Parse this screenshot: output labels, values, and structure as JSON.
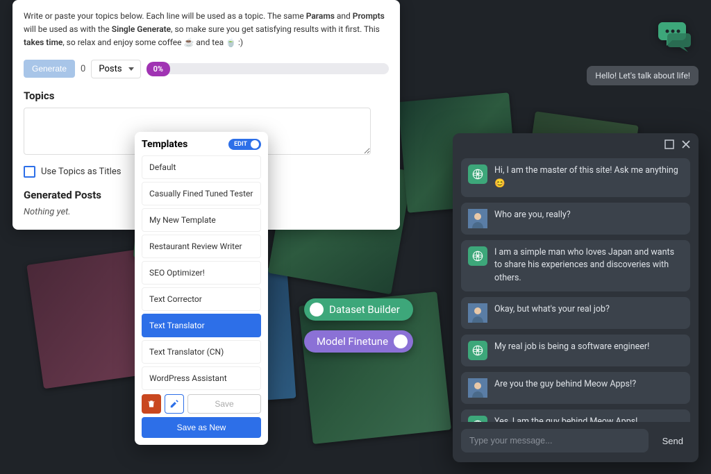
{
  "editor": {
    "intro_parts": {
      "t1": "Write or paste your topics below. Each line will be used as a topic. The same ",
      "b1": "Params",
      "t2": " and ",
      "b2": "Prompts",
      "t3": " will be used as with the ",
      "b3": "Single Generate",
      "t4": ", so make sure you get satisfying results with it first. This ",
      "b4": "takes time",
      "t5": ", so relax and enjoy some coffee ☕ and tea 🍵 :)"
    },
    "generate_label": "Generate",
    "count": "0",
    "select_label": "Posts",
    "progress": "0%",
    "topics_title": "Topics",
    "checkbox_label": "Use Topics as Titles",
    "generated_title": "Generated Posts",
    "nothing": "Nothing yet."
  },
  "templates": {
    "title": "Templates",
    "edit_label": "EDIT",
    "items": [
      {
        "label": "Default"
      },
      {
        "label": "Casually Fined Tuned Tester"
      },
      {
        "label": "My New Template"
      },
      {
        "label": "Restaurant Review Writer"
      },
      {
        "label": "SEO Optimizer!"
      },
      {
        "label": "Text Corrector"
      },
      {
        "label": "Text Translator"
      },
      {
        "label": "Text Translator (CN)"
      },
      {
        "label": "WordPress Assistant"
      }
    ],
    "selected_index": 6,
    "save_label": "Save",
    "save_new_label": "Save as New"
  },
  "pills": {
    "dataset": "Dataset Builder",
    "finetune": "Model Finetune"
  },
  "hello": "Hello! Let's talk about life!",
  "chat": {
    "messages": [
      {
        "role": "ai",
        "text": "Hi, I am the master of this site! Ask me anything 😊"
      },
      {
        "role": "user",
        "text": "Who are you, really?"
      },
      {
        "role": "ai",
        "text": "I am a simple man who loves Japan and wants to share his experiences and discoveries with others."
      },
      {
        "role": "user",
        "text": "Okay, but what's your real job?"
      },
      {
        "role": "ai",
        "text": "My real job is being a software engineer!"
      },
      {
        "role": "user",
        "text": "Are you the guy behind Meow Apps!?"
      },
      {
        "role": "ai",
        "text": "Yes, I am the guy behind Meow Apps!"
      }
    ],
    "placeholder": "Type your message...",
    "send_label": "Send"
  }
}
